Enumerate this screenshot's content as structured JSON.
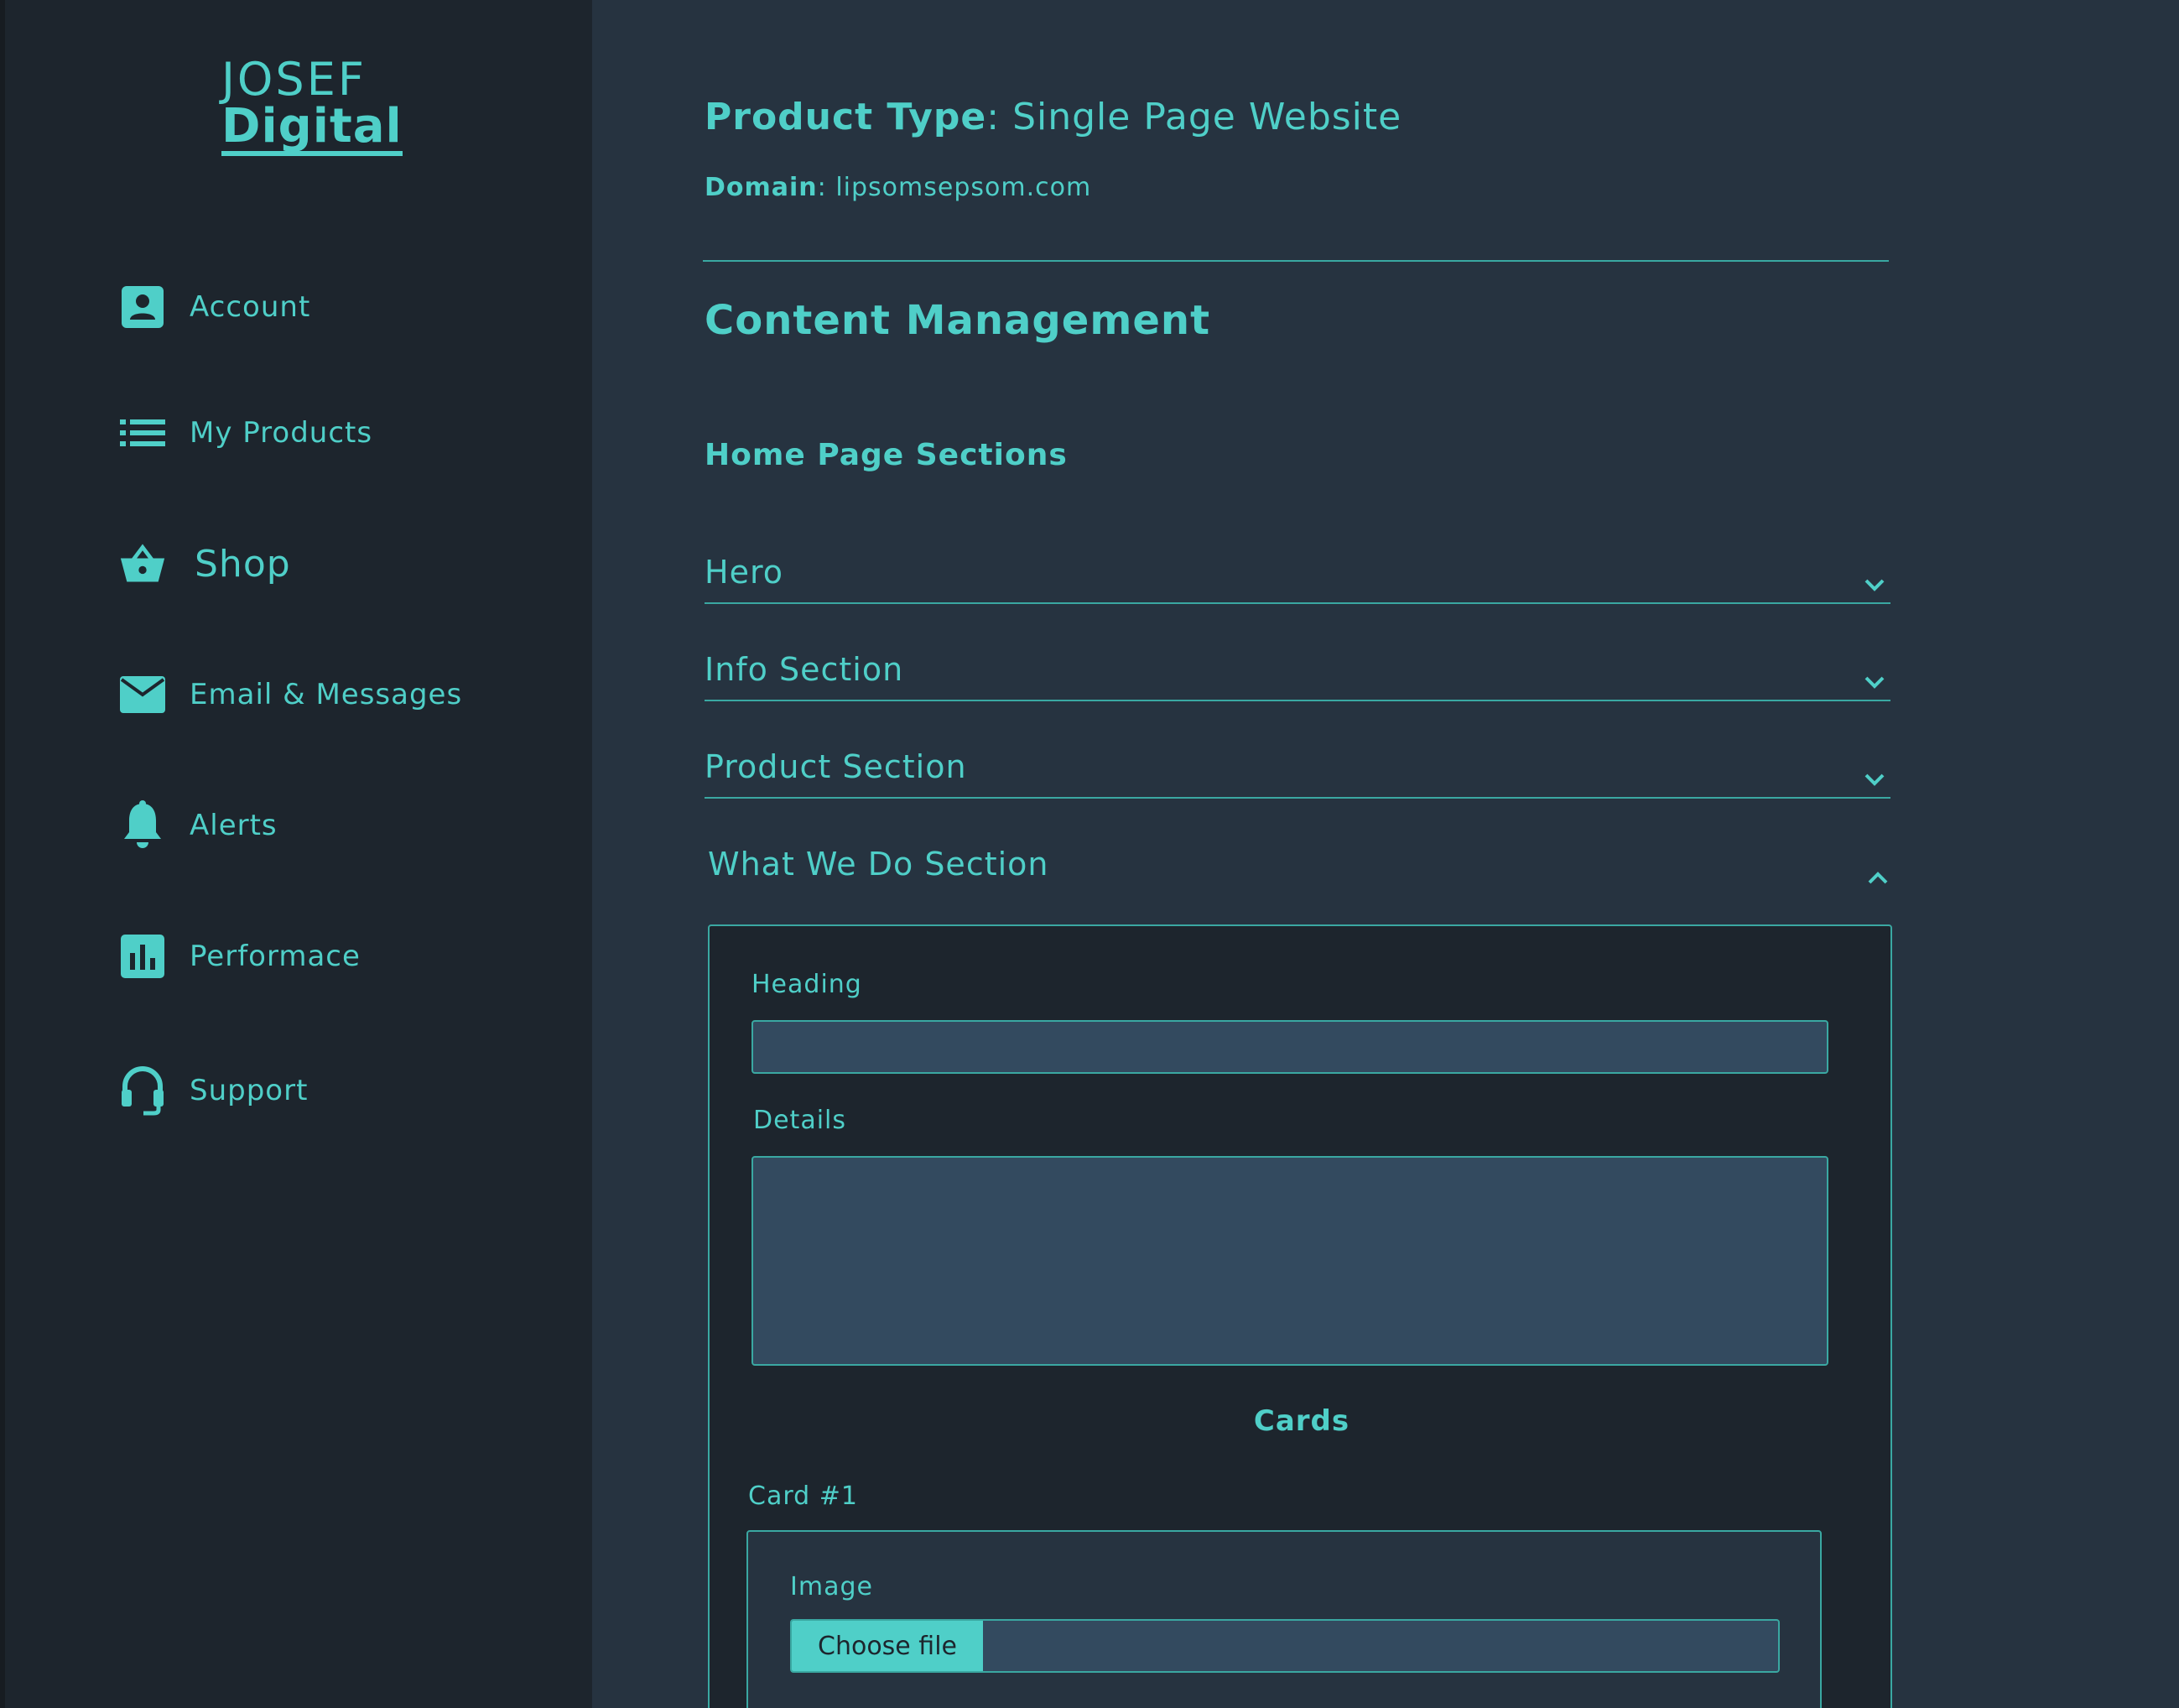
{
  "brand": {
    "line1": "JOSEF",
    "line2": "Digital"
  },
  "sidebar": {
    "items": [
      {
        "label": "Account",
        "icon": "account-icon"
      },
      {
        "label": "My Products",
        "icon": "list-icon"
      },
      {
        "label": "Shop",
        "icon": "basket-icon"
      },
      {
        "label": "Email & Messages",
        "icon": "envelope-icon"
      },
      {
        "label": "Alerts",
        "icon": "bell-icon"
      },
      {
        "label": "Performace",
        "icon": "bar-chart-icon"
      },
      {
        "label": "Support",
        "icon": "headset-icon"
      }
    ]
  },
  "header": {
    "product_type_label": "Product Type",
    "product_type_value": "Single Page Website",
    "domain_label": "Domain",
    "domain_value": "lipsomsepsom.com"
  },
  "content": {
    "title": "Content Management",
    "sections_title": "Home Page Sections",
    "accordion": [
      {
        "label": "Hero",
        "state": "collapsed"
      },
      {
        "label": "Info Section",
        "state": "collapsed"
      },
      {
        "label": "Product Section",
        "state": "collapsed"
      },
      {
        "label": "What We Do Section",
        "state": "expanded"
      }
    ],
    "panel": {
      "heading_label": "Heading",
      "heading_value": "",
      "details_label": "Details",
      "details_value": "",
      "cards_title": "Cards",
      "card1_label": "Card #1",
      "image_label": "Image",
      "choose_file_label": "Choose file"
    }
  },
  "colors": {
    "accent": "#4fcfc8",
    "sidebar_bg": "#1d252d",
    "main_bg": "#263340",
    "input_bg": "#334a5f"
  }
}
